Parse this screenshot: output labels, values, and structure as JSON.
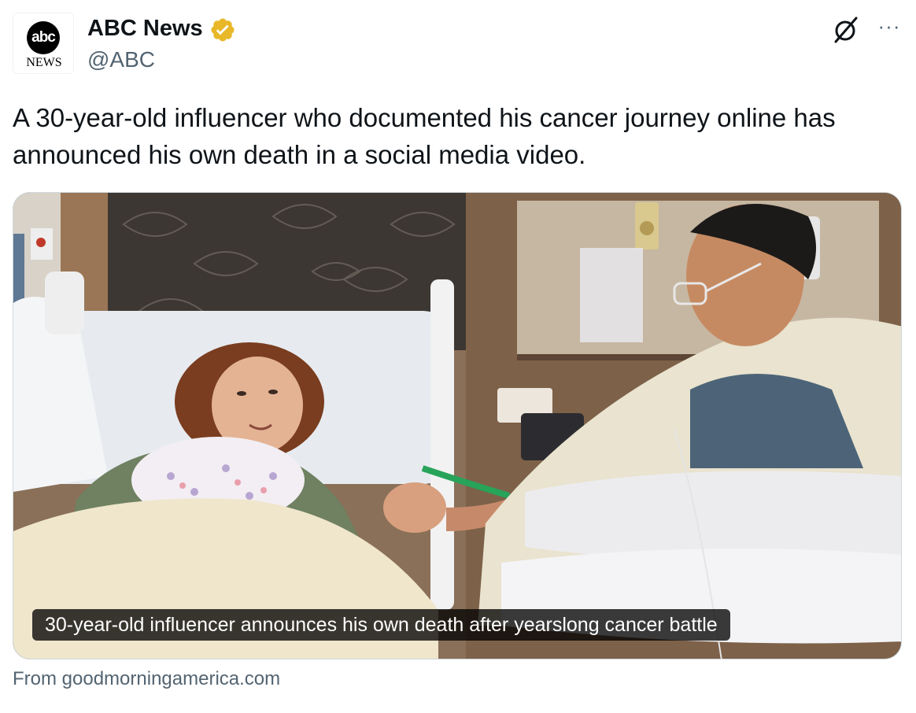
{
  "account": {
    "avatar": {
      "logo_text": "abc",
      "news_text": "NEWS"
    },
    "display_name": "ABC News",
    "handle": "@ABC",
    "verified_icon": "gold-verified-badge",
    "verified_color": "#e8b829"
  },
  "actions": {
    "grok_icon": "grok-icon",
    "more_label": "···"
  },
  "tweet": {
    "text": "A 30-year-old influencer who documented his cancer journey online has announced his own death in a social media video."
  },
  "link_card": {
    "image": "hospital-room-photo",
    "title": "30-year-old influencer announces his own death after yearslong cancer battle",
    "source": "From goodmorningamerica.com"
  }
}
